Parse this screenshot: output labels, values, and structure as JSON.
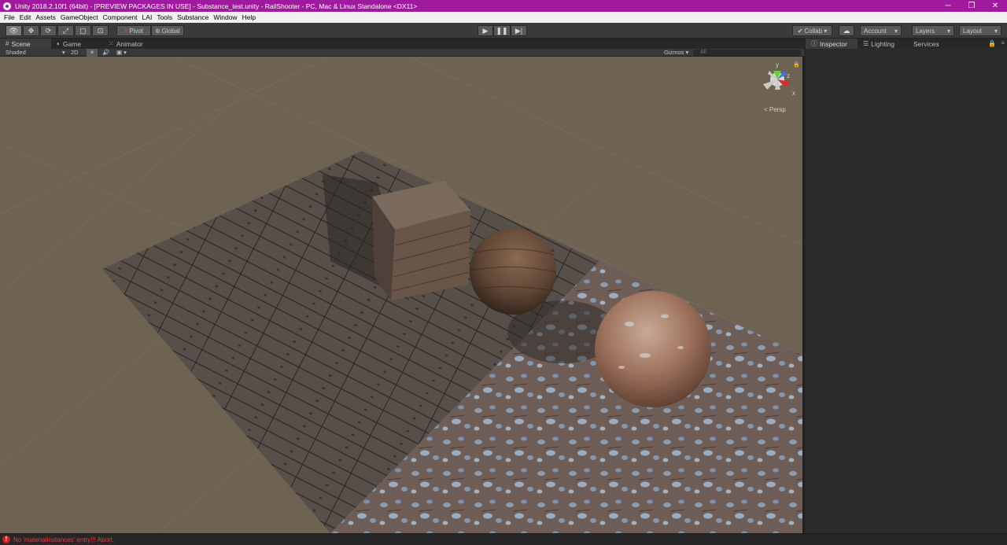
{
  "window": {
    "title": "Unity 2018.2.10f1 (64bit) - [PREVIEW PACKAGES IN USE] - Substance_test.unity - RailShooter - PC, Mac & Linux Standalone <DX11>",
    "controls": [
      "─",
      "❐",
      "✕"
    ],
    "accent_color": "#a01aa0"
  },
  "menu": [
    "File",
    "Edit",
    "Assets",
    "GameObject",
    "Component",
    "LAI",
    "Tools",
    "Substance",
    "Window",
    "Help"
  ],
  "toolbar": {
    "tools": [
      "view-tool-icon",
      "move-tool-icon",
      "rotate-tool-icon",
      "scale-tool-icon",
      "rect-tool-icon",
      "transform-tool-icon"
    ],
    "pivot_label": "Pivot",
    "global_label": "Global",
    "collab_label": "Collab ▾",
    "account_label": "Account",
    "layers_label": "Layers",
    "layout_label": "Layout"
  },
  "tabs": {
    "scene": "Scene",
    "game": "Game",
    "animator": "Animator",
    "inspector": "Inspector",
    "lighting": "Lighting",
    "services": "Services"
  },
  "scene_bar": {
    "shading": "Shaded",
    "mode_2d": "2D",
    "gizmos": "Gizmos ▾",
    "search_placeholder": "All"
  },
  "scene_gizmo": {
    "projection": "Persp",
    "axis_y": "y",
    "axis_z": "z",
    "axis_x": "x"
  },
  "console": {
    "message": "No 'materialInstances' entry!!! Abort.",
    "error_color": "#e04040"
  }
}
